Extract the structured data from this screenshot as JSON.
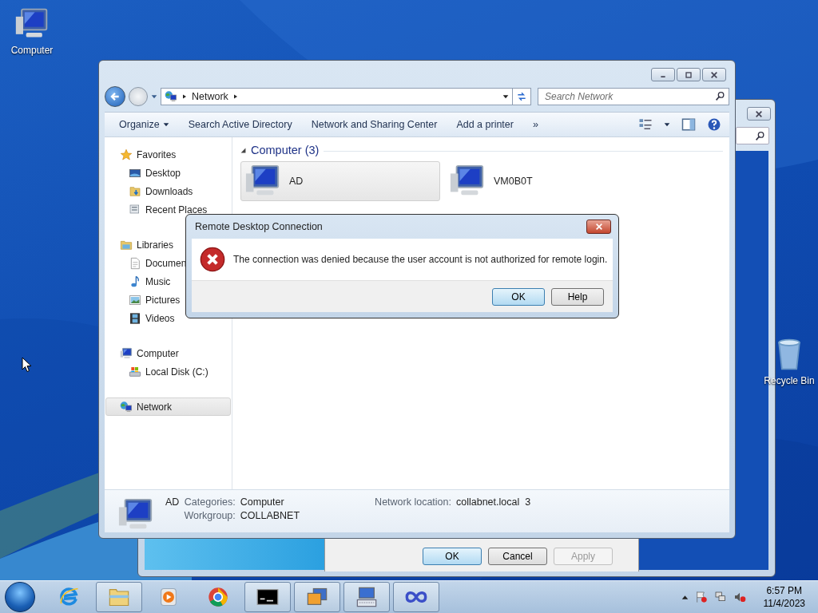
{
  "desktop_icons": [
    {
      "kind": "computer",
      "label": "Computer"
    },
    {
      "kind": "recycle",
      "label": "Recycle Bin"
    }
  ],
  "back_window": {
    "buttons": [
      {
        "label": "OK",
        "default": true,
        "disabled": false
      },
      {
        "label": "Cancel",
        "default": false,
        "disabled": false
      },
      {
        "label": "Apply",
        "default": false,
        "disabled": true
      }
    ]
  },
  "explorer": {
    "address": [
      "Network"
    ],
    "search": {
      "placeholder": "Search Network"
    },
    "toolbar": [
      {
        "label": "Organize",
        "dropdown": true
      },
      {
        "label": "Search Active Directory",
        "dropdown": false
      },
      {
        "label": "Network and Sharing Center",
        "dropdown": false
      },
      {
        "label": "Add a printer",
        "dropdown": false
      },
      {
        "label": "»",
        "dropdown": false
      }
    ],
    "nav": [
      {
        "kind": "star",
        "label": "Favorites",
        "selected": false,
        "children": [
          {
            "kind": "desktop",
            "label": "Desktop",
            "selected": false
          },
          {
            "kind": "downloads",
            "label": "Downloads",
            "selected": false
          },
          {
            "kind": "recent",
            "label": "Recent Places",
            "selected": false
          }
        ]
      },
      {
        "kind": "libraries",
        "label": "Libraries",
        "selected": false,
        "children": [
          {
            "kind": "document",
            "label": "Documen",
            "selected": false
          },
          {
            "kind": "music",
            "label": "Music",
            "selected": false
          },
          {
            "kind": "pictures",
            "label": "Pictures",
            "selected": false
          },
          {
            "kind": "videos",
            "label": "Videos",
            "selected": false
          }
        ]
      },
      {
        "kind": "computer",
        "label": "Computer",
        "selected": false,
        "children": [
          {
            "kind": "disk",
            "label": "Local Disk (C:)",
            "selected": false
          }
        ]
      },
      {
        "kind": "network",
        "label": "Network",
        "selected": true
      }
    ],
    "group": {
      "title": "Computer (3)",
      "items": [
        {
          "label": "AD",
          "selected": true
        },
        {
          "label": "VM0B0T",
          "selected": false
        }
      ]
    },
    "details": {
      "name": "AD",
      "fields": [
        {
          "label": "Categories:",
          "value": "Computer"
        },
        {
          "label": "Workgroup:",
          "value": "COLLABNET"
        },
        {
          "label": "Network location:",
          "value": "collabnet.local  3"
        }
      ]
    }
  },
  "dialog": {
    "title": "Remote Desktop Connection",
    "message": "The connection was denied because the user account is not authorized for remote login.",
    "buttons": [
      {
        "label": "OK",
        "default": true
      },
      {
        "label": "Help",
        "default": false
      }
    ]
  },
  "taskbar": {
    "apps": [
      {
        "kind": "ie",
        "running": false
      },
      {
        "kind": "folder",
        "running": true
      },
      {
        "kind": "media",
        "running": false
      },
      {
        "kind": "browser",
        "running": false
      },
      {
        "kind": "cmd",
        "running": true
      },
      {
        "kind": "rdp",
        "running": true
      },
      {
        "kind": "keyboard",
        "running": true
      },
      {
        "kind": "infinity",
        "running": true
      }
    ],
    "time": "6:57 PM",
    "date": "11/4/2023"
  }
}
